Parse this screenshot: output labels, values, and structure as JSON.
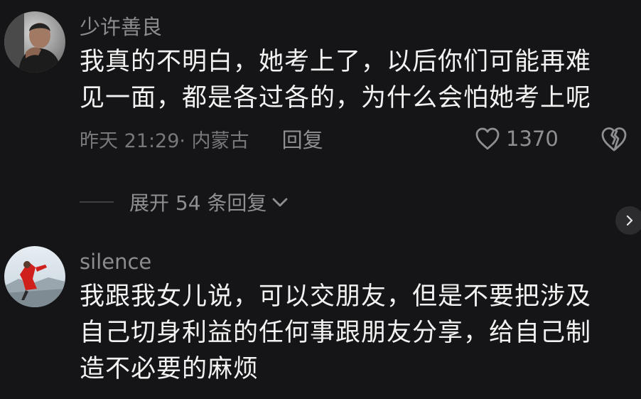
{
  "colors": {
    "background": "#151517",
    "primary_text": "#f2f2f2",
    "secondary_text": "#8c8c8f",
    "divider": "#3f3f42"
  },
  "comments": [
    {
      "username": "少许善良",
      "lines": [
        "我真的不明白，她考上了，以后你们可能再难",
        "见一面，都是各过各的，为什么会怕她考上呢"
      ],
      "meta": "昨天 21:29· 内蒙古",
      "reply_label": "回复",
      "like_count": "1370",
      "avatar_icon": "user-avatar-photo",
      "like_icon": "heart-outline-icon",
      "dislike_icon": "broken-heart-icon"
    },
    {
      "username": "silence",
      "lines": [
        "我跟我女儿说，可以交朋友，但是不要把涉及",
        "自己切身利益的任何事跟朋友分享，给自己制",
        "造不必要的麻烦"
      ],
      "avatar_icon": "user-avatar-photo"
    }
  ],
  "expand_replies": {
    "label": "展开 54 条回复",
    "icon": "chevron-down-icon"
  },
  "side_arrow_icon": "chevron-right-icon"
}
